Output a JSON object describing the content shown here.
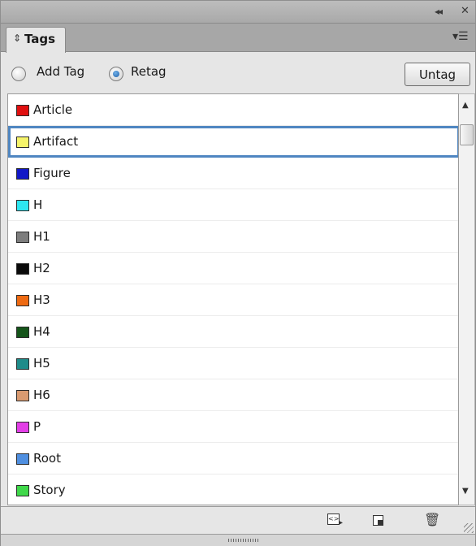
{
  "panel": {
    "title_controls": {
      "collapse_icon": "double-chevron-left-icon",
      "close_icon": "close-icon"
    },
    "tab": {
      "label": "Tags",
      "icon": "up-down-chevron-icon"
    },
    "menu_icon": "panel-menu-icon"
  },
  "controls": {
    "add_tag_label": "Add Tag",
    "retag_label": "Retag",
    "selected_mode": "Retag",
    "untag_label": "Untag"
  },
  "tags": [
    {
      "label": "Article",
      "color": "#e01010"
    },
    {
      "label": "Artifact",
      "color": "#f6f46a",
      "selected": true
    },
    {
      "label": "Figure",
      "color": "#1218c8"
    },
    {
      "label": "H",
      "color": "#2de6f0"
    },
    {
      "label": "H1",
      "color": "#7d7d7d"
    },
    {
      "label": "H2",
      "color": "#0a0a0a"
    },
    {
      "label": "H3",
      "color": "#ee6a12"
    },
    {
      "label": "H4",
      "color": "#15551a"
    },
    {
      "label": "H5",
      "color": "#1f8c8a"
    },
    {
      "label": "H6",
      "color": "#d99a70"
    },
    {
      "label": "P",
      "color": "#e23ee6"
    },
    {
      "label": "Root",
      "color": "#4f8fe0"
    },
    {
      "label": "Story",
      "color": "#3fd84a"
    }
  ],
  "selection_color": "#4f86c1",
  "bottom_toolbar": {
    "icons": [
      "new-tag-from-frame-icon",
      "place-icon",
      "trash-icon",
      "resize-grip-icon"
    ]
  }
}
